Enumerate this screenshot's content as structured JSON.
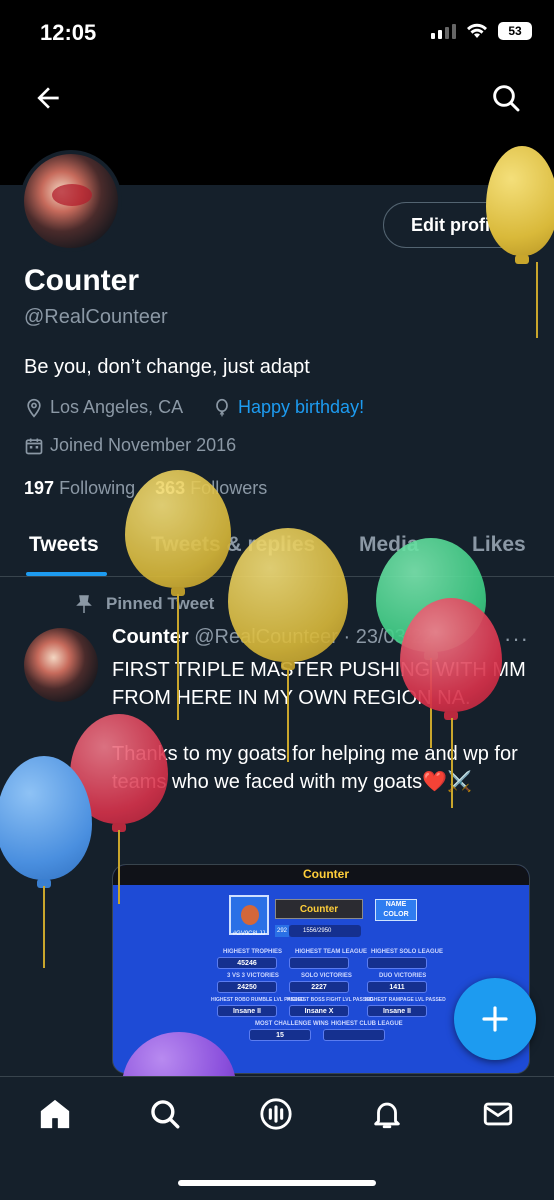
{
  "status": {
    "time": "12:05",
    "battery": "53"
  },
  "profile": {
    "name": "Counter",
    "handle": "@RealCounteer",
    "bio": "Be you, don’t change, just adapt",
    "location": "Los Angeles, CA",
    "birthday": "Happy birthday!",
    "joined": "Joined November 2016",
    "following_count": "197",
    "following_label": "Following",
    "followers_count": "363",
    "followers_label": "Followers",
    "edit_label": "Edit profile"
  },
  "tabs": [
    {
      "label": "Tweets",
      "active": true
    },
    {
      "label": "Tweets & replies",
      "active": false
    },
    {
      "label": "Media",
      "active": false
    },
    {
      "label": "Likes",
      "active": false
    }
  ],
  "tweet": {
    "pinned_label": "Pinned Tweet",
    "author": "Counter",
    "meta": "@RealCounteer · 23/03/22",
    "more": "···",
    "text": "FIRST TRIPLE MASTER PUSHING WITH MM FROM HERE IN MY OWN REGION NA.\n\nThanks to my goats for helping me and wp for teams who we faced with my goats❤️⚔️"
  },
  "media": {
    "title": "Counter",
    "player_name": "Counter",
    "name_color": "NAME COLOR",
    "tag": "#GV9C8LJJ",
    "level": "292",
    "trophy_progress": "1556/2950",
    "stats": [
      {
        "label": "HIGHEST TROPHIES",
        "value": "45246"
      },
      {
        "label": "HIGHEST TEAM LEAGUE",
        "value": ""
      },
      {
        "label": "HIGHEST SOLO LEAGUE",
        "value": ""
      },
      {
        "label": "3 VS 3 VICTORIES",
        "value": "24250"
      },
      {
        "label": "SOLO VICTORIES",
        "value": "2227"
      },
      {
        "label": "DUO VICTORIES",
        "value": "1411"
      },
      {
        "label": "HIGHEST ROBO RUMBLE LVL PASSED",
        "value": "Insane II"
      },
      {
        "label": "HIGHEST BOSS FIGHT LVL PASSED",
        "value": "Insane X"
      },
      {
        "label": "HIGHEST RAMPAGE LVL PASSED",
        "value": "Insane II"
      },
      {
        "label": "MOST CHALLENGE WINS",
        "value": "15"
      },
      {
        "label": "HIGHEST CLUB LEAGUE",
        "value": ""
      }
    ]
  },
  "nav": [
    "home-icon",
    "search-icon",
    "spaces-icon",
    "notifications-icon",
    "messages-icon"
  ],
  "colors": {
    "accent": "#1d9bf0",
    "background": "#15202b",
    "muted": "#8b98a5"
  }
}
